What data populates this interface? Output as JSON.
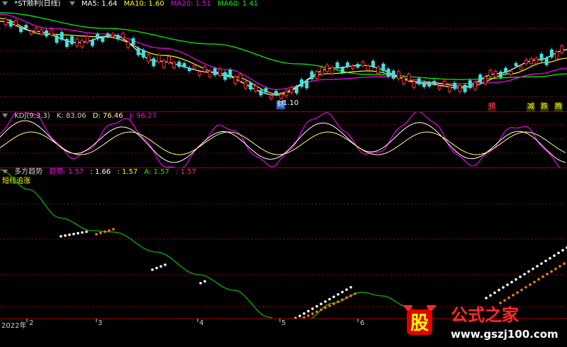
{
  "main_header": {
    "title": "*ST顺利(日线)",
    "ma5": "MA5: 1.64",
    "ma10": "MA10: 1.60",
    "ma20": "MA20: 1.51",
    "ma60": "MA60: 1.41"
  },
  "price_markers": {
    "low_price": "1.10",
    "cai": "财",
    "yu": "预",
    "jian": "减",
    "die": "跌",
    "teng": "腾"
  },
  "kdj_header": {
    "name": "KDJ(9,3,3)",
    "k": "K: 83.06",
    "d": "D: 76.46",
    "j": "J: 96.27"
  },
  "trend_header": {
    "name": "多方趋势",
    "trend": "趋势: 1.57",
    "v2": ": 1.66",
    "v3": ": 1.57",
    "a": "A: 1.57",
    "v5": ": 1.57"
  },
  "trend_annotation": "短线追涨",
  "x_axis": {
    "labels": [
      "2022年",
      "2",
      "3",
      "4",
      "5",
      "6"
    ]
  },
  "watermark": {
    "glyph": "股",
    "text": "公式之家",
    "url": "www.gszj100.com"
  },
  "colors": {
    "ma5": "#ffffff",
    "ma10": "#ffff00",
    "ma20": "#ff00ff",
    "ma60": "#00ff00",
    "up": "#ff3030",
    "down": "#40e0e0",
    "grid": "#a00000",
    "trend_line": "#00c000",
    "trend_dots_white": "#ffffff",
    "trend_dots_orange": "#ff8000"
  }
}
